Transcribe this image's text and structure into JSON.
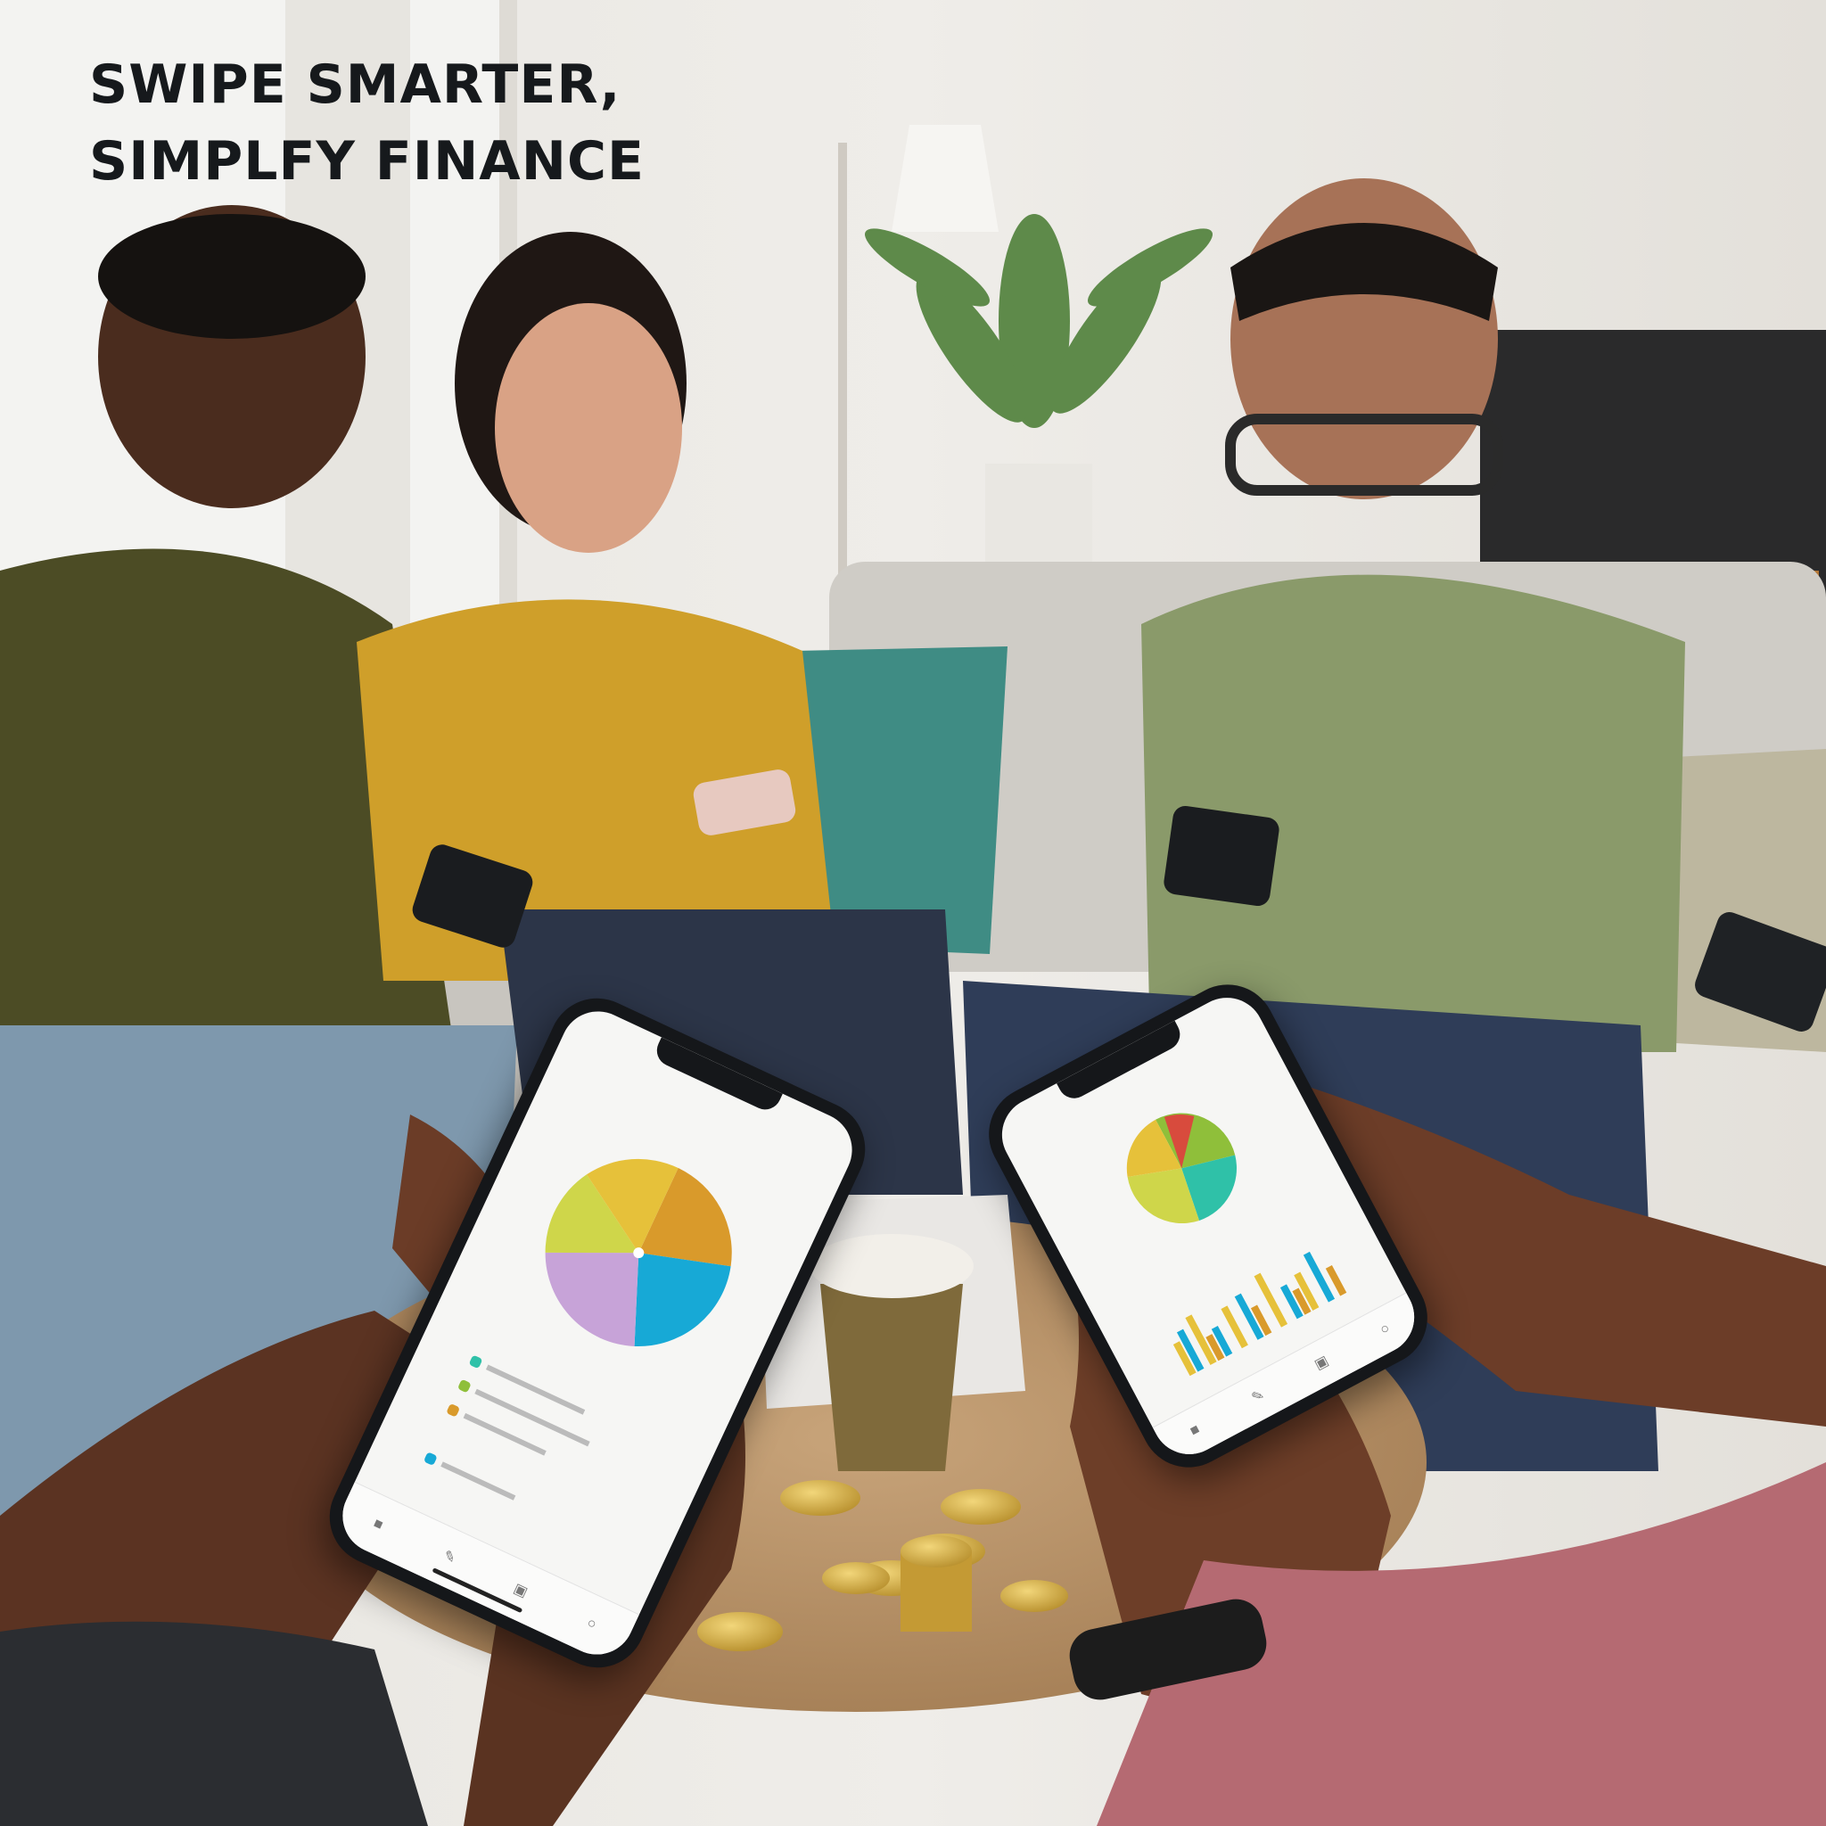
{
  "headline": {
    "line1": "SWIPE SMARTER,",
    "line2": "SIMPLFY FINANCE"
  },
  "colors": {
    "pie_blue": "#17a9d6",
    "pie_yellow": "#e6c13a",
    "pie_orange": "#d99a2b",
    "pie_lime": "#cfd64a",
    "pie_lilac": "#c7a3d8",
    "pie_green": "#8fbf3a",
    "pie_teal": "#2fc1a8",
    "pie_red": "#d84b3d"
  },
  "icons": {
    "tab_home": "lock-icon",
    "tab_stats": "pen-icon",
    "tab_cards": "wallet-icon",
    "tab_profile": "bell-icon"
  }
}
